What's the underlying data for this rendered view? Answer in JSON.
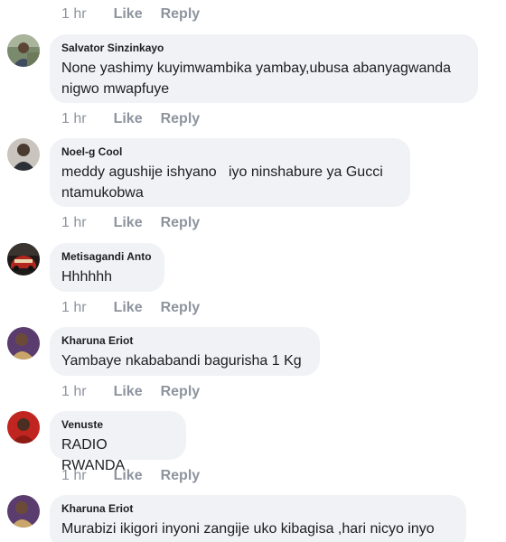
{
  "actions": {
    "like_label": "Like",
    "reply_label": "Reply"
  },
  "comments": [
    {
      "time": "1 hr"
    },
    {
      "author": "Salvator Sinzinkayo",
      "text": "None yashimy kuyimwambika yambay,ubusa abanyagwanda nigwo mwapfuye",
      "time": "1 hr",
      "avatar_icon": "person-photo-avatar"
    },
    {
      "author": "Noel-g Cool",
      "text": "meddy agushije ishyano   iyo ninshabure ya Gucci ntamukobwa",
      "time": "1 hr",
      "avatar_icon": "person-photo-avatar"
    },
    {
      "author": "Metisagandi Anto",
      "text": "Hhhhhh",
      "time": "1 hr",
      "avatar_icon": "car-photo-avatar"
    },
    {
      "author": "Kharuna Eriot",
      "text": "Yambaye nkababandi bagurisha 1 Kg",
      "time": "1 hr",
      "avatar_icon": "person-photo-avatar"
    },
    {
      "author": "Venuste",
      "text": "RADIO RWANDA",
      "time": "1 hr",
      "avatar_icon": "person-red-photo-avatar"
    },
    {
      "author": "Kharuna Eriot",
      "text": "Murabizi ikigori inyoni zangije uko kibagisa ,hari nicyo inyo",
      "avatar_icon": "person-photo-avatar"
    }
  ]
}
